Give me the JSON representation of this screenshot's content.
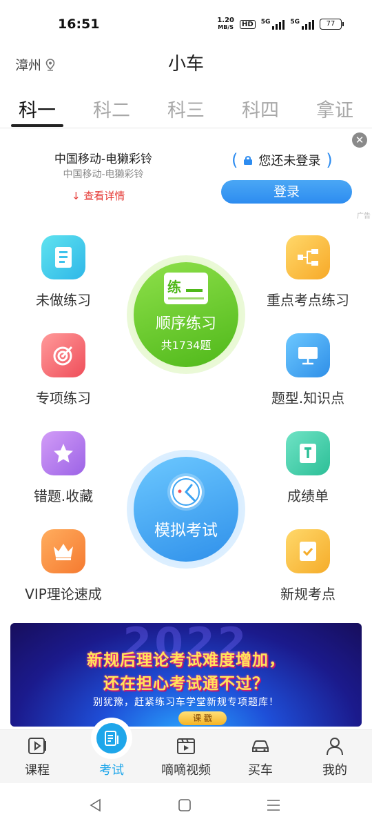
{
  "status_bar": {
    "time": "16:51",
    "speed_value": "1.20",
    "speed_unit": "MB/S",
    "hd": "HD",
    "signal1_label": "5G",
    "signal2_label": "5G",
    "battery": "77"
  },
  "header": {
    "city": "漳州",
    "title": "小车"
  },
  "tabs": [
    "科一",
    "科二",
    "科三",
    "科四",
    "拿证"
  ],
  "active_tab": "科一",
  "ad": {
    "title": "中国移动-电獭彩铃",
    "subtitle": "中国移动-电獭彩铃",
    "detail_link": "查看详情",
    "login_status": "您还未登录",
    "login_button": "登录",
    "ad_mark": "广告"
  },
  "features": {
    "left": [
      "未做练习",
      "专项练习",
      "错题.收藏",
      "VIP理论速成"
    ],
    "right": [
      "重点考点练习",
      "题型.知识点",
      "成绩单",
      "新规考点"
    ]
  },
  "sequential_practice": {
    "icon_text": "练",
    "label": "顺序练习",
    "count": "共1734题"
  },
  "mock_exam": {
    "label": "模拟考试"
  },
  "banner": {
    "year": "2022",
    "line1": "新规后理论考试难度增加，",
    "line2": "还在担心考试通不过？",
    "line3": "别犹豫，赶紧练习车学堂新规专项题库！",
    "button": "课  戳"
  },
  "bottom_nav": [
    {
      "label": "课程",
      "icon": "video-play-icon"
    },
    {
      "label": "考试",
      "icon": "exam-sheet-icon"
    },
    {
      "label": "嘀嘀视频",
      "icon": "film-icon"
    },
    {
      "label": "买车",
      "icon": "car-icon"
    },
    {
      "label": "我的",
      "icon": "person-icon"
    }
  ],
  "active_nav": "考试",
  "colors": {
    "accent_blue": "#2d8cf0",
    "nav_active": "#1ea6ea",
    "practice_green": "#5cc21d",
    "exam_blue": "#3aa6f5",
    "detail_red": "#e53935"
  }
}
